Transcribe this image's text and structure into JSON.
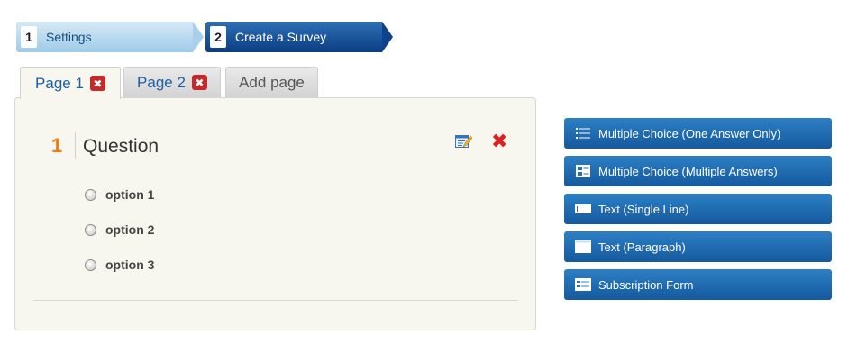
{
  "wizard": {
    "steps": [
      {
        "number": "1",
        "label": "Settings"
      },
      {
        "number": "2",
        "label": "Create a Survey"
      }
    ]
  },
  "tabs": {
    "page1": {
      "label": "Page 1",
      "delete_glyph": "✖"
    },
    "page2": {
      "label": "Page 2",
      "delete_glyph": "✖"
    },
    "add": {
      "label": "Add page"
    }
  },
  "question": {
    "number": "1",
    "title": "Question",
    "delete_glyph": "✖",
    "options": [
      "option 1",
      "option 2",
      "option 3"
    ]
  },
  "question_types": [
    {
      "label": "Multiple Choice (One Answer Only)",
      "icon": "list-icon"
    },
    {
      "label": "Multiple Choice (Multiple Answers)",
      "icon": "checklist-icon"
    },
    {
      "label": "Text (Single Line)",
      "icon": "single-line-icon"
    },
    {
      "label": "Text (Paragraph)",
      "icon": "paragraph-icon"
    },
    {
      "label": "Subscription Form",
      "icon": "form-icon"
    }
  ],
  "colors": {
    "accent_blue": "#15599e",
    "step_active": "#0b3d82",
    "question_number": "#f07d12",
    "delete_red": "#dd2020"
  }
}
